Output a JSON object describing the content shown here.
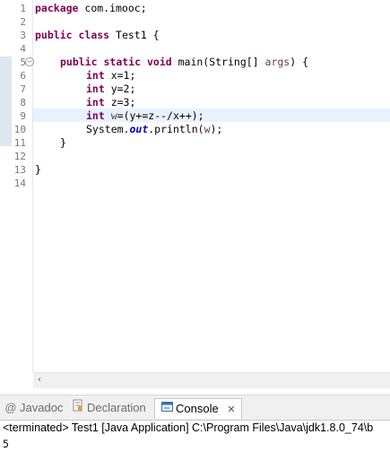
{
  "editor": {
    "line_numbers": [
      "1",
      "2",
      "3",
      "4",
      "5",
      "6",
      "7",
      "8",
      "9",
      "10",
      "11",
      "12",
      "13",
      "14"
    ],
    "lines": [
      {
        "kw": "package",
        "rest": " com.imooc;"
      },
      {
        "text": ""
      },
      {
        "kw": "public",
        "kw2": "class",
        "rest": " Test1 {"
      },
      {
        "text": ""
      },
      {
        "kw": "public",
        "kw2": "static",
        "kw3": "void",
        "rest_a": " main(String[] ",
        "param": "args",
        "rest_b": ") {"
      },
      {
        "kw": "int",
        "rest": " x=1;"
      },
      {
        "kw": "int",
        "rest": " y=2;"
      },
      {
        "kw": "int",
        "rest": " z=3;"
      },
      {
        "kw": "int",
        "var": "w",
        "rest": "=(y+=z--/x++);"
      },
      {
        "rest_a": "System.",
        "field": "out",
        "rest_b": ".println(",
        "var": "w",
        "rest_c": ");"
      },
      {
        "text": "}"
      },
      {
        "text": ""
      },
      {
        "text": "}"
      },
      {
        "text": ""
      }
    ]
  },
  "scrollbar": {
    "left_arrow": "‹"
  },
  "tabs": [
    {
      "label": "Javadoc",
      "icon": "@"
    },
    {
      "label": "Declaration",
      "icon": "declaration-icon"
    },
    {
      "label": "Console",
      "icon": "console-icon",
      "close": "✕"
    }
  ],
  "console": {
    "header": "<terminated> Test1 [Java Application] C:\\Program Files\\Java\\jdk1.8.0_74\\b",
    "output": "5"
  }
}
